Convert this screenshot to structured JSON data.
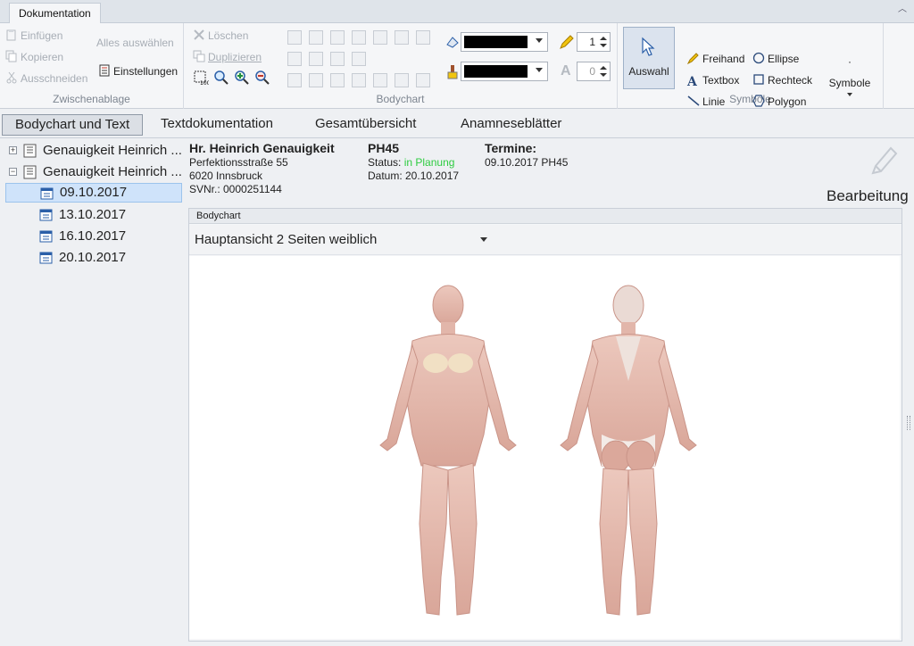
{
  "ribbon_tab": "Dokumentation",
  "groups": {
    "clipboard": {
      "label": "Zwischenablage",
      "paste": "Einfügen",
      "copy": "Kopieren",
      "cut": "Ausschneiden",
      "select_all": "Alles auswählen",
      "settings": "Einstellungen"
    },
    "bodychart": {
      "label": "Bodychart",
      "delete": "Löschen",
      "duplicate": "Duplizieren",
      "line_width": "1",
      "font_size": "0"
    },
    "symbols": {
      "label": "Symbole",
      "select": "Auswahl",
      "freehand": "Freihand",
      "textbox": "Textbox",
      "line": "Linie",
      "ellipse": "Ellipse",
      "rectangle": "Rechteck",
      "polygon": "Polygon",
      "symbols_menu": "Symbole",
      "symbols_dot": "·"
    }
  },
  "colors": {
    "stroke": "#000000",
    "fill": "#000000"
  },
  "view_tabs": [
    "Bodychart und Text",
    "Textdokumentation",
    "Gesamtübersicht",
    "Anamneseblätter"
  ],
  "tree": {
    "items": [
      {
        "label": "Genauigkeit Heinrich ...",
        "expander": "+"
      },
      {
        "label": "Genauigkeit Heinrich ...",
        "expander": "−"
      }
    ],
    "dates": [
      "09.10.2017",
      "13.10.2017",
      "16.10.2017",
      "20.10.2017"
    ]
  },
  "patient": {
    "name": "Hr. Heinrich Genauigkeit",
    "street": "Perfektionsstraße 55",
    "city": "6020 Innsbruck",
    "svnr": "SVNr.: 0000251144"
  },
  "record": {
    "code": "PH45",
    "status_label": "Status:",
    "status_value": "in Planung",
    "date": "Datum: 20.10.2017"
  },
  "appointments": {
    "title": "Termine:",
    "entry": "09.10.2017 PH45"
  },
  "edit_label": "Bearbeitung",
  "bodychart_panel": {
    "title": "Bodychart",
    "view": "Hauptansicht 2 Seiten weiblich"
  }
}
